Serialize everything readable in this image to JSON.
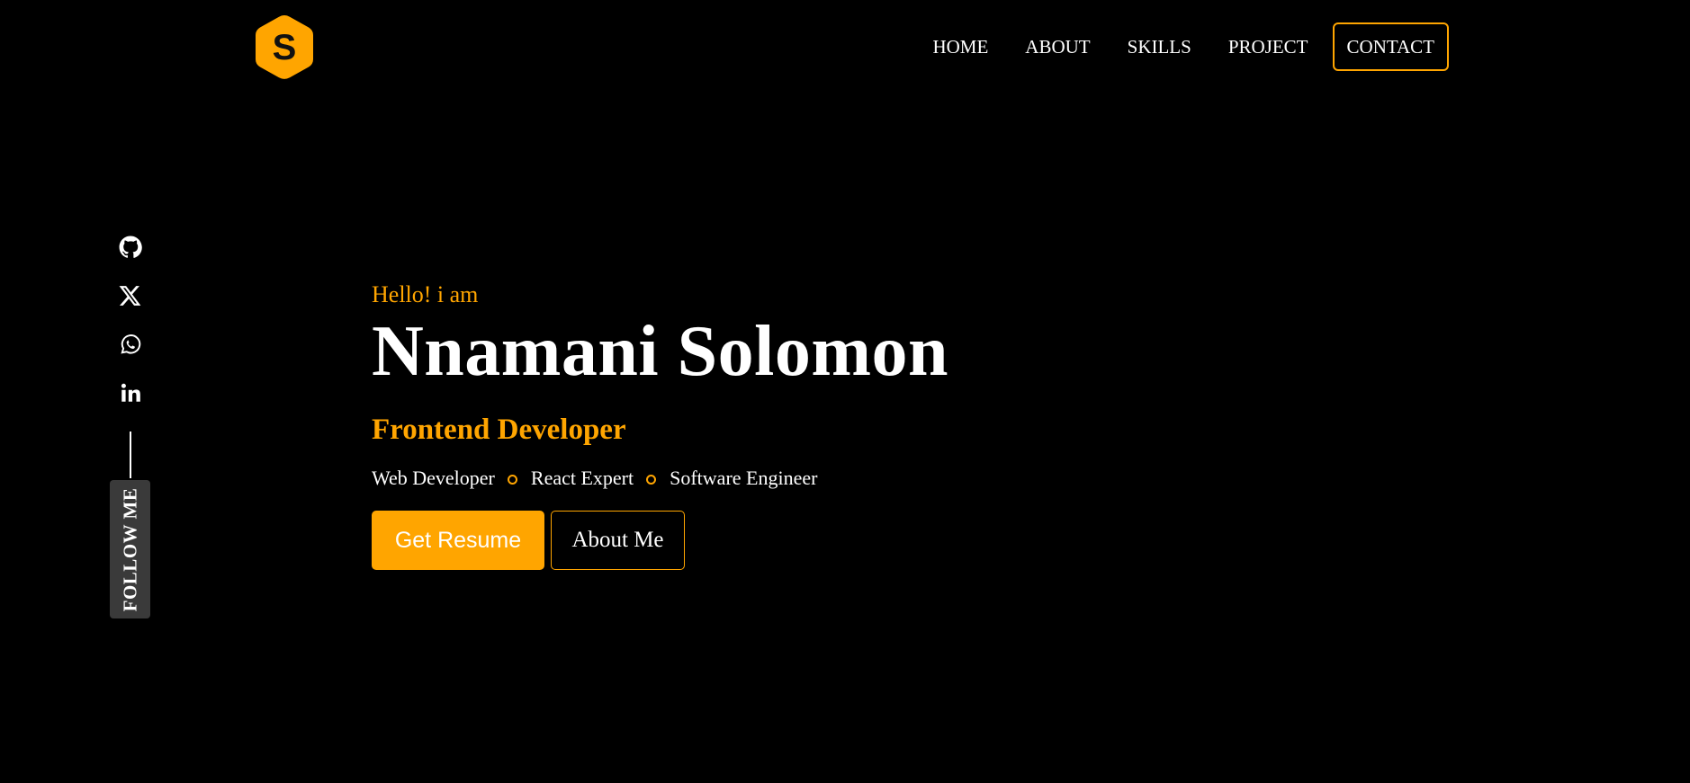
{
  "brand": {
    "logo_letter": "S",
    "accent": "#ffa500",
    "background": "#000000"
  },
  "nav": {
    "items": [
      {
        "label": "HOME"
      },
      {
        "label": "ABOUT"
      },
      {
        "label": "SKILLS"
      },
      {
        "label": "PROJECT"
      }
    ],
    "contact_label": "CONTACT"
  },
  "social": {
    "icons": [
      "github-icon",
      "x-twitter-icon",
      "whatsapp-icon",
      "linkedin-icon"
    ],
    "follow_label": "FOLLOW ME"
  },
  "hero": {
    "greeting": "Hello! i am",
    "name": "Nnamani Solomon",
    "role": "Frontend Developer",
    "tags": [
      "Web Developer",
      "React Expert",
      "Software Engineer"
    ],
    "primary_button": "Get Resume",
    "secondary_button": "About Me"
  }
}
